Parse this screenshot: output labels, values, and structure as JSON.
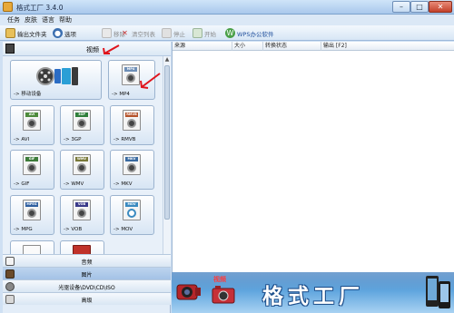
{
  "window": {
    "title": "格式工厂 3.4.0",
    "buttons": {
      "minimize": "–",
      "maximize": "□",
      "close": "✕"
    }
  },
  "menu": [
    "任务",
    "皮肤",
    "语言",
    "帮助"
  ],
  "toolbar": {
    "output_folder": "输出文件夹",
    "options": "选项",
    "remove": "移除",
    "clear_list": "清空列表",
    "stop": "停止",
    "start": "开始",
    "office": "WPS办公软件"
  },
  "left_panel": {
    "category": "视频",
    "tiles": [
      {
        "label": "-> 移动设备",
        "icon": "mobile-device-icon",
        "color": "#3a3a3a"
      },
      {
        "label": "-> MP4",
        "icon": "mp4-icon",
        "badge": "MP4",
        "color": "#6e8fb7"
      },
      {
        "label": "-> AVI",
        "icon": "avi-icon",
        "badge": "AVI",
        "color": "#4d8a3a"
      },
      {
        "label": "-> 3GP",
        "icon": "3gp-icon",
        "badge": "3GP",
        "color": "#2f7f3a"
      },
      {
        "label": "-> RMVB",
        "icon": "rmvb-icon",
        "badge": "RMVB",
        "color": "#b6532a"
      },
      {
        "label": "-> GIF",
        "icon": "gif-icon",
        "badge": "GIF",
        "color": "#3e7c3a"
      },
      {
        "label": "-> WMV",
        "icon": "wmv-icon",
        "badge": "WMV",
        "color": "#7a7a3a"
      },
      {
        "label": "-> MKV",
        "icon": "mkv-icon",
        "badge": "MKV",
        "color": "#3a6aa0"
      },
      {
        "label": "-> MPG",
        "icon": "mpg-icon",
        "badge": "MPEG",
        "color": "#2f5fa0"
      },
      {
        "label": "-> VOB",
        "icon": "vob-icon",
        "badge": "VOB",
        "color": "#3a3a8a"
      },
      {
        "label": "-> MOV",
        "icon": "mov-icon",
        "badge": "MOV",
        "color": "#3a8ac0"
      },
      {
        "label": "",
        "icon": "file-icon",
        "badge": "",
        "color": "#c0c0c0"
      },
      {
        "label": "",
        "icon": "flash-icon",
        "badge": "",
        "color": "#c0322a"
      }
    ],
    "nav": [
      {
        "label": "音频",
        "icon": "audio-icon"
      },
      {
        "label": "图片",
        "icon": "picture-icon",
        "selected": true
      },
      {
        "label": "光驱设备\\DVD\\CD\\ISO",
        "icon": "disc-icon"
      },
      {
        "label": "高级",
        "icon": "advanced-icon"
      }
    ]
  },
  "file_list": {
    "columns": [
      "来源",
      "大小",
      "转换状态",
      "输出 [F2]"
    ]
  },
  "banner": {
    "slogan": "视频",
    "brand": "格式工厂"
  },
  "colors": {
    "accent": "#2a6fb8",
    "annotation_arrow": "#e0141c"
  }
}
